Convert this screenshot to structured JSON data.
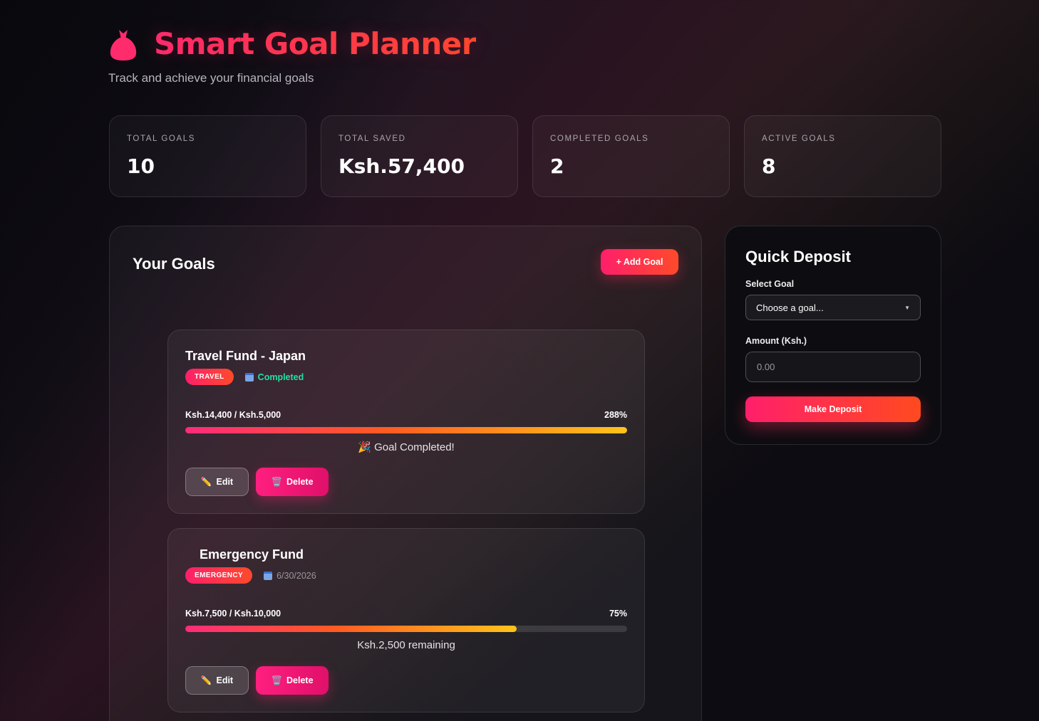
{
  "header": {
    "title": "Smart Goal Planner",
    "subtitle": "Track and achieve your financial goals",
    "icon": "money-bag-icon"
  },
  "stats": [
    {
      "label": "TOTAL GOALS",
      "value": "10"
    },
    {
      "label": "TOTAL SAVED",
      "value": "Ksh.57,400"
    },
    {
      "label": "COMPLETED GOALS",
      "value": "2"
    },
    {
      "label": "ACTIVE GOALS",
      "value": "8"
    }
  ],
  "goals_panel": {
    "title": "Your Goals",
    "add_button": "+ Add Goal"
  },
  "goals": [
    {
      "name": "Travel Fund - Japan",
      "category": "TRAVEL",
      "date": "Completed",
      "amounts": "Ksh.14,400 / Ksh.5,000",
      "percent": "288%",
      "progress": 1.0,
      "status": "🎉 Goal Completed!",
      "edit": "Edit",
      "delete": "Delete"
    },
    {
      "name": "Emergency Fund",
      "category": "EMERGENCY",
      "date": "6/30/2026",
      "amounts": "Ksh.7,500 / Ksh.10,000",
      "percent": "75%",
      "progress": 0.75,
      "status": "Ksh.2,500 remaining",
      "edit": "Edit",
      "delete": "Delete"
    }
  ],
  "deposit": {
    "title": "Quick Deposit",
    "select_label": "Select Goal",
    "select_value": "Choose a goal...",
    "amount_label": "Amount (Ksh.)",
    "amount_placeholder": "0.00",
    "button": "Make Deposit"
  },
  "colors": {
    "accent": "#ff1f6b",
    "accent2": "#ff4a2a",
    "success": "#23e0a0"
  }
}
